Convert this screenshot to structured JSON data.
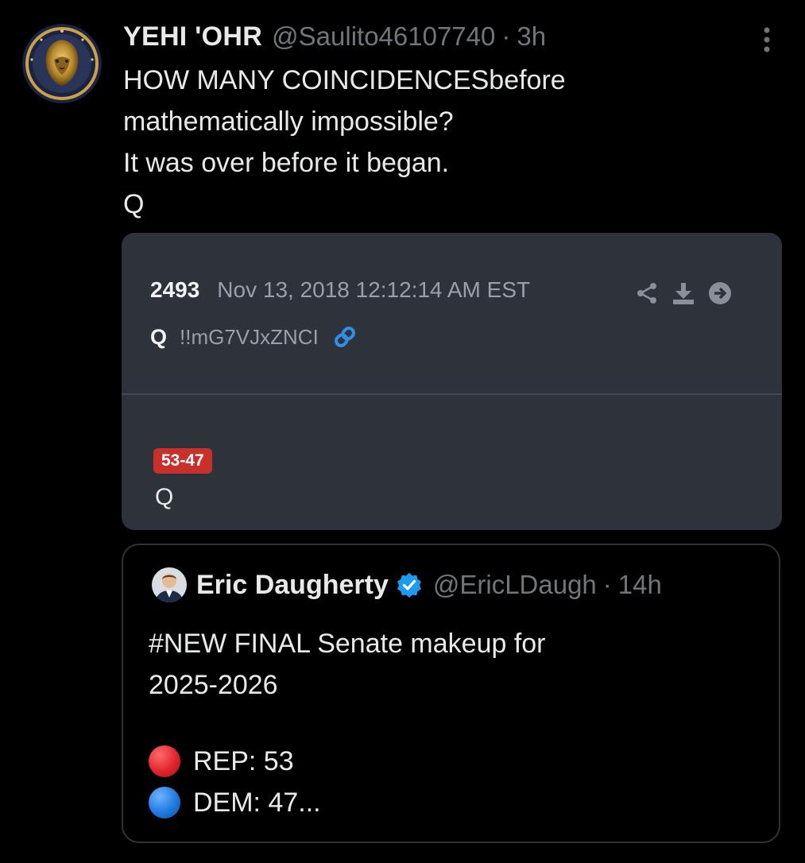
{
  "tweet": {
    "display_name": "YEHI 'OHR",
    "handle": "@Saulito46107740",
    "separator": "·",
    "time": "3h",
    "more_icon": "more-vertical-icon",
    "avatar_icon": "lion-emblem-avatar",
    "text_lines": [
      "HOW MANY COINCIDENCESbefore",
      "mathematically impossible?",
      "It was over before it began.",
      "Q"
    ]
  },
  "q_card": {
    "post_number": "2493",
    "date": "Nov 13, 2018 12:12:14 AM EST",
    "author": "Q",
    "tripcode": "!!mG7VJxZNCI",
    "badge": "53-47",
    "body": "Q",
    "actions": [
      "share-icon",
      "download-icon",
      "arrow-right-icon"
    ],
    "link_icon": "link-icon",
    "badge_color": "#c9302c",
    "background_color": "#2e323b"
  },
  "quoted_tweet": {
    "display_name": "Eric Daugherty",
    "verified_icon": "verified-badge-icon",
    "handle": "@EricLDaugh",
    "separator": "·",
    "time": "14h",
    "text_lines": [
      "#NEW FINAL Senate makeup for",
      "2025-2026"
    ],
    "rep_line": "REP: 53",
    "dem_line": "DEM: 47...",
    "rep_color": "#e0252d",
    "dem_color": "#1f7ae0"
  },
  "colors": {
    "background": "#000000",
    "text_primary": "#e7e9ea",
    "text_secondary": "#71767b",
    "verified_blue": "#1d9bf0"
  }
}
